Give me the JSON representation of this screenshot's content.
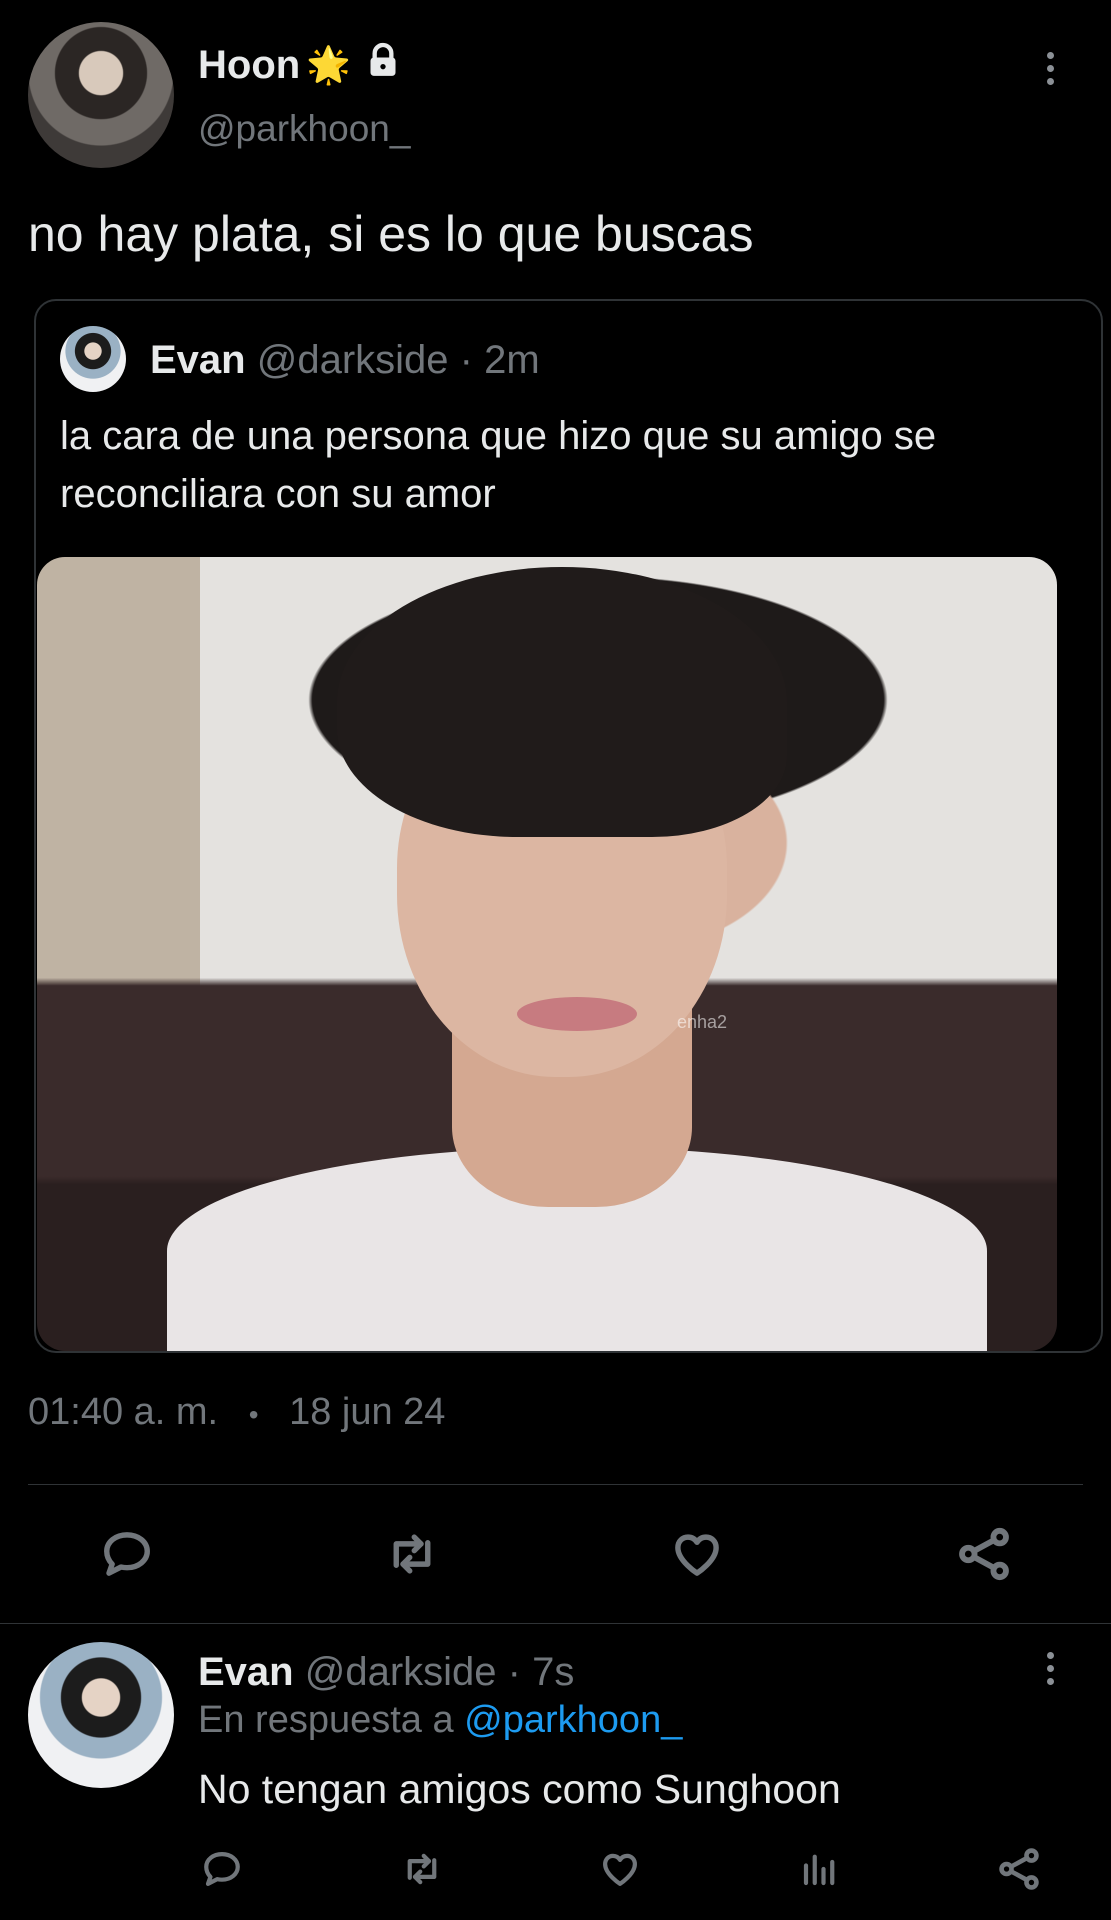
{
  "tweet": {
    "author": {
      "name": "Hoon",
      "name_emoji": "🌟",
      "handle": "@parkhoon_",
      "lock_icon": "lock-icon"
    },
    "text": "no hay plata, si es lo que buscas",
    "quoted": {
      "name": "Evan",
      "handle": "@darkside",
      "time": "· 2m",
      "text": "la cara de una persona que hizo que su amigo se reconciliara con su amor",
      "watermark": "enha2"
    },
    "time": "01:40 a. m.",
    "dot": "•",
    "date": "18 jun 24",
    "actions": [
      "reply-icon",
      "retweet-icon",
      "like-icon",
      "share-icon"
    ]
  },
  "reply": {
    "name": "Evan",
    "handle": "@darkside",
    "time": "· 7s",
    "in_reply_prefix": "En respuesta a",
    "in_reply_handle": "@parkhoon_",
    "text": "No tengan amigos como Sunghoon",
    "actions": [
      "reply-icon",
      "retweet-icon",
      "like-icon",
      "views-icon",
      "share-icon"
    ]
  },
  "colors": {
    "background": "#000000",
    "text": "#e7e9ea",
    "muted": "#71767b",
    "link": "#1d9bf0",
    "border": "#2f3336"
  }
}
